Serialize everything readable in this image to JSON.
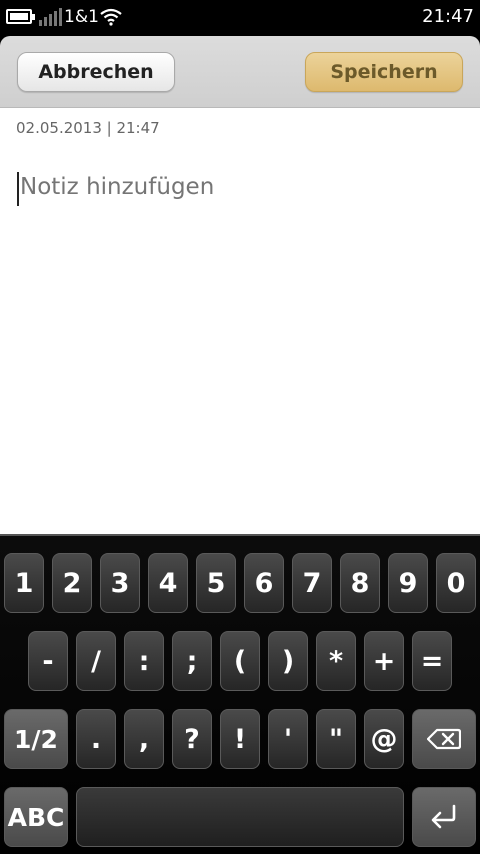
{
  "status_bar": {
    "carrier": "1&1",
    "time": "21:47"
  },
  "toolbar": {
    "cancel_label": "Abbrechen",
    "save_label": "Speichern"
  },
  "note": {
    "timestamp": "02.05.2013 | 21:47",
    "placeholder": "Notiz hinzufügen"
  },
  "keyboard": {
    "row1": [
      "1",
      "2",
      "3",
      "4",
      "5",
      "6",
      "7",
      "8",
      "9",
      "0"
    ],
    "row2": [
      "-",
      "/",
      ":",
      ";",
      "(",
      ")",
      "*",
      "+",
      "="
    ],
    "row3": [
      "1/2",
      ".",
      ",",
      "?",
      "!",
      "'",
      "\"",
      "@"
    ],
    "abc_label": "ABC"
  }
}
